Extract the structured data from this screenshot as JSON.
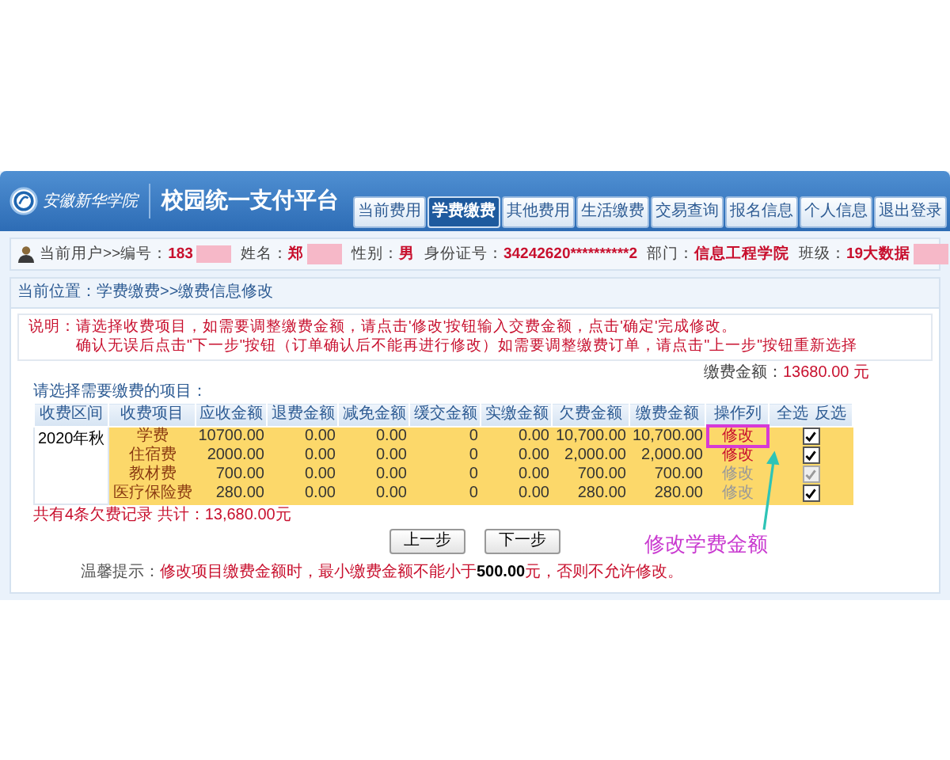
{
  "header": {
    "school_name": "安徽新华学院",
    "title": "校园统一支付平台"
  },
  "tabs": [
    {
      "label": "当前费用",
      "selected": false
    },
    {
      "label": "学费缴费",
      "selected": true
    },
    {
      "label": "其他费用",
      "selected": false
    },
    {
      "label": "生活缴费",
      "selected": false
    },
    {
      "label": "交易查询",
      "selected": false
    },
    {
      "label": "报名信息",
      "selected": false
    },
    {
      "label": "个人信息",
      "selected": false
    },
    {
      "label": "退出登录",
      "selected": false
    }
  ],
  "user_bar": {
    "label": "当前用户>>",
    "fields": [
      {
        "label": "编号：",
        "value": "183",
        "redacted": true
      },
      {
        "label": "姓名：",
        "value": "郑",
        "redacted": true
      },
      {
        "label": "性别：",
        "value": "男",
        "redacted": false
      },
      {
        "label": "身份证号：",
        "value": "34242620**********2",
        "redacted": false
      },
      {
        "label": "部门：",
        "value": "信息工程学院",
        "redacted": false
      },
      {
        "label": "班级：",
        "value": "19大数据",
        "redacted": true
      }
    ]
  },
  "breadcrumb": "当前位置：学费缴费>>缴费信息修改",
  "notes": [
    "说明：请选择收费项目，如需要调整缴费金额，请点击'修改'按钮输入交费金额，点击'确定'完成修改。",
    "确认无误后点击\"下一步\"按钮（订单确认后不能再进行修改）如需要调整缴费订单，请点击\"上一步\"按钮重新选择"
  ],
  "payment_total": {
    "label": "缴费金额：",
    "value": "13680.00 元"
  },
  "table_caption": "请选择需要缴费的项目：",
  "table": {
    "columns": [
      "收费区间",
      "收费项目",
      "应收金额",
      "退费金额",
      "减免金额",
      "缓交金额",
      "实缴金额",
      "欠费金额",
      "缴费金额",
      "操作列"
    ],
    "select_all": "全选",
    "invert": "反选",
    "rows": [
      {
        "cells": [
          {
            "text": "2020年秋",
            "rowspan": 4
          },
          "学费",
          "10700.00",
          "0.00",
          "0.00",
          "0",
          "0.00",
          "10,700.00",
          "10,700.00"
        ],
        "action": "修改",
        "action_enabled": true,
        "highlighted": true,
        "checked": true,
        "check_disabled": false
      },
      {
        "cells": [
          "住宿费",
          "2000.00",
          "0.00",
          "0.00",
          "0",
          "0.00",
          "2,000.00",
          "2,000.00"
        ],
        "action": "修改",
        "action_enabled": true,
        "highlighted": false,
        "checked": true,
        "check_disabled": false
      },
      {
        "cells": [
          "教材费",
          "700.00",
          "0.00",
          "0.00",
          "0",
          "0.00",
          "700.00",
          "700.00"
        ],
        "action": "修改",
        "action_enabled": false,
        "highlighted": false,
        "checked": true,
        "check_disabled": true
      },
      {
        "cells": [
          "医疗保险费",
          "280.00",
          "0.00",
          "0.00",
          "0",
          "0.00",
          "280.00",
          "280.00"
        ],
        "action": "修改",
        "action_enabled": false,
        "highlighted": false,
        "checked": true,
        "check_disabled": false
      }
    ]
  },
  "summary": "共有4条欠费记录  共计：13,680.00元",
  "buttons": [
    "上一步",
    "下一步"
  ],
  "tip": {
    "label": "温馨提示：",
    "text": "修改项目缴费金额时，最小缴费金额不能小于**500.00**元，否则不允许修改。"
  },
  "annotation": {
    "text": "修改学费金额"
  }
}
